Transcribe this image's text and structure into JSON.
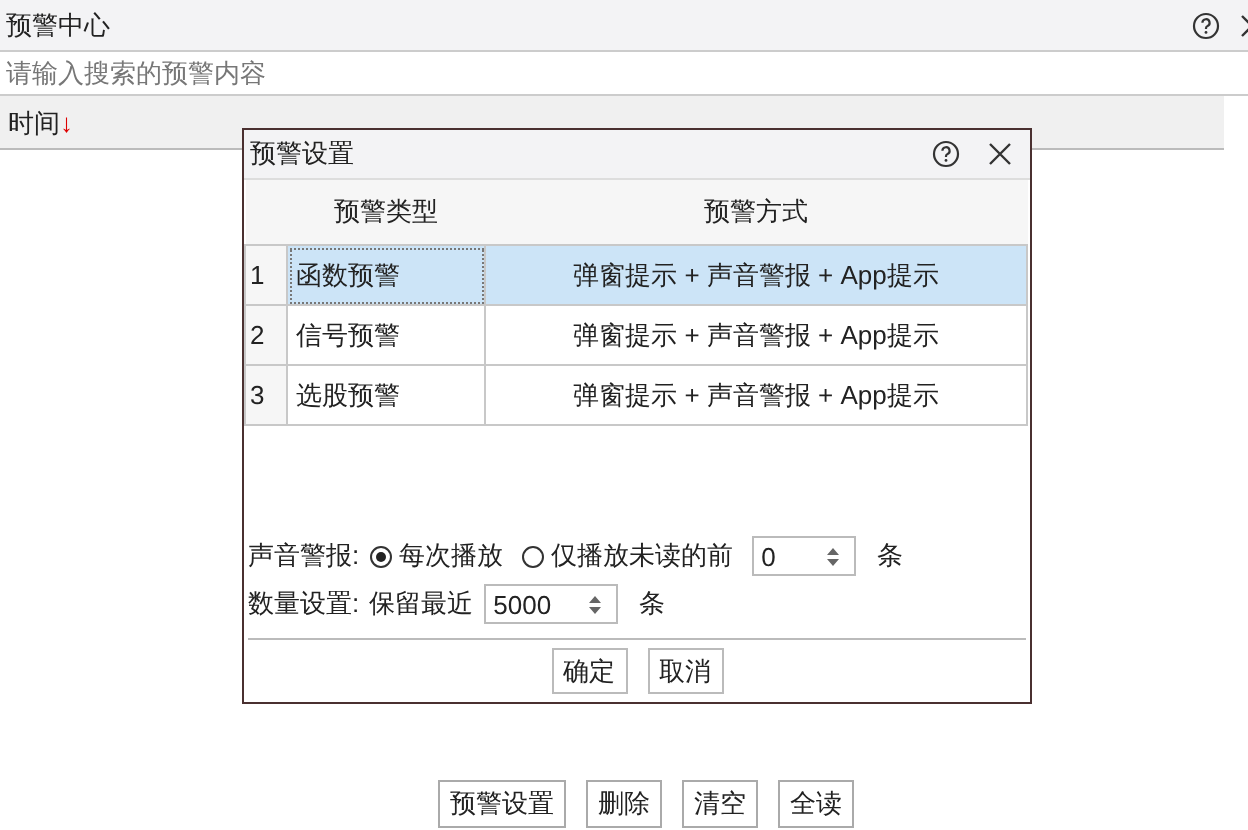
{
  "window": {
    "title": "预警中心"
  },
  "search": {
    "placeholder": "请输入搜索的预警内容"
  },
  "columns": [
    {
      "label": "时间",
      "sort_indicator": "↓"
    }
  ],
  "dialog": {
    "title": "预警设置",
    "table": {
      "columns": [
        "预警类型",
        "预警方式"
      ],
      "rows": [
        {
          "index": "1",
          "type": "函数预警",
          "method": "弹窗提示 + 声音警报 + App提示",
          "selected": true
        },
        {
          "index": "2",
          "type": "信号预警",
          "method": "弹窗提示 + 声音警报 + App提示",
          "selected": false
        },
        {
          "index": "3",
          "type": "选股预警",
          "method": "弹窗提示 + 声音警报 + App提示",
          "selected": false
        }
      ]
    },
    "sound": {
      "label": "声音警报:",
      "options": [
        {
          "label": "每次播放",
          "selected": true
        },
        {
          "label": "仅播放未读的前",
          "selected": false
        }
      ],
      "value": "0",
      "unit": "条"
    },
    "count": {
      "label": "数量设置:",
      "prefix": "保留最近",
      "value": "5000",
      "unit": "条"
    },
    "buttons": [
      "确定",
      "取消"
    ]
  },
  "bottom_buttons": [
    "预警设置",
    "删除",
    "清空",
    "全读"
  ]
}
